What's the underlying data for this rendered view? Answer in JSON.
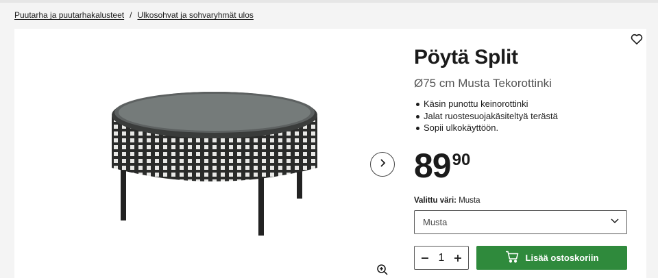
{
  "breadcrumb": {
    "items": [
      "Puutarha ja puutarhakalusteet",
      "Ulkosohvat ja sohvaryhmät ulos"
    ],
    "separator": "/"
  },
  "product": {
    "title": "Pöytä Split",
    "subtitle": "Ø75 cm Musta Tekorottinki",
    "bullets": [
      "Käsin punottu keinorottinki",
      "Jalat ruostesuojakäsiteltyä terästä",
      "Sopii ulkokäyttöön."
    ],
    "price_main": "89",
    "price_cents": "90",
    "color_label": "Valittu väri:",
    "color_value": "Musta",
    "color_select_value": "Musta",
    "quantity": "1",
    "add_to_cart_label": "Lisää ostoskoriin"
  },
  "icons": {
    "favorite": "heart-icon",
    "next": "chevron-right-icon",
    "zoom": "zoom-in-icon",
    "dropdown": "chevron-down-icon",
    "decrement": "minus-icon",
    "increment": "plus-icon",
    "cart": "cart-icon"
  },
  "colors": {
    "cart_button": "#2f8a3c",
    "background": "#f4f4f4",
    "card": "#ffffff"
  }
}
